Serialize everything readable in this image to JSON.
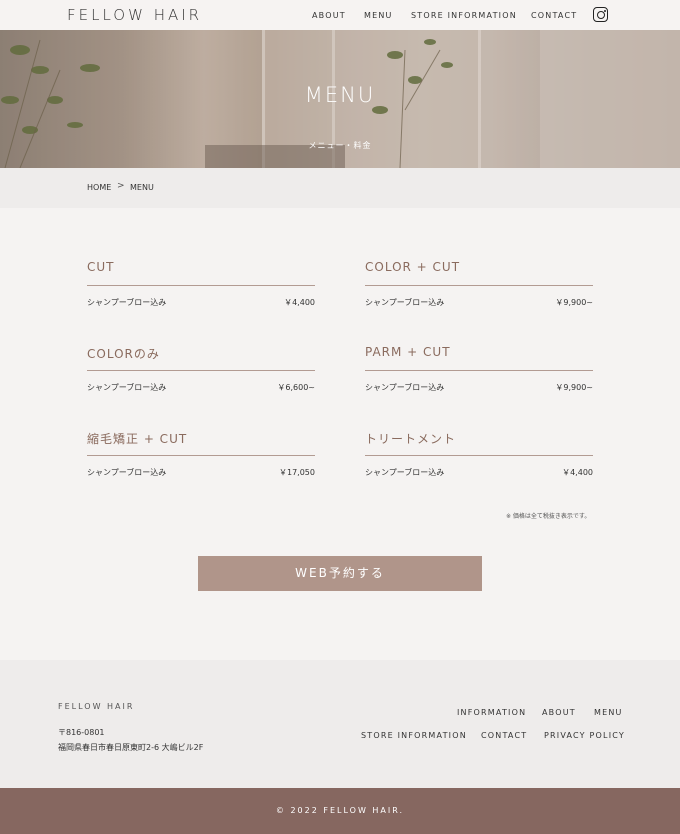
{
  "header": {
    "logo": "FELLOW HAIR",
    "nav": [
      "ABOUT",
      "MENU",
      "STORE INFORMATION",
      "CONTACT"
    ],
    "icon": "instagram-icon"
  },
  "hero": {
    "title": "MENU",
    "subtitle": "メニュー・料金"
  },
  "breadcrumb": {
    "home": "HOME",
    "separator": ">",
    "current": "MENU"
  },
  "menu": [
    {
      "name": "CUT",
      "desc": "シャンプーブロー込み",
      "price": "￥4,400"
    },
    {
      "name": "COLOR + CUT",
      "desc": "シャンプーブロー込み",
      "price": "￥9,900~"
    },
    {
      "name": "COLORのみ",
      "desc": "シャンプーブロー込み",
      "price": "￥6,600~"
    },
    {
      "name": "PARM + CUT",
      "desc": "シャンプーブロー込み",
      "price": "￥9,900~"
    },
    {
      "name": "縮毛矯正 + CUT",
      "desc": "シャンプーブロー込み",
      "price": "￥17,050"
    },
    {
      "name": "トリートメント",
      "desc": "シャンプーブロー込み",
      "price": "￥4,400"
    }
  ],
  "note": "※ 価格は全て税抜き表示です。",
  "cta": {
    "label": "WEB予約する"
  },
  "footer": {
    "logo": "FELLOW HAIR",
    "zip": "〒816-0801",
    "address": "福岡県春日市春日原東町2-6 大嶋ビル2F",
    "links_row1": [
      "INFORMATION",
      "ABOUT",
      "MENU"
    ],
    "links_row2": [
      "STORE INFORMATION",
      "CONTACT",
      "PRIVACY POLICY"
    ]
  },
  "copyright": "© 2022 FELLOW HAIR.",
  "colors": {
    "accent": "#b0958a",
    "footer_bar": "#866760",
    "menu_title": "#8a6b5e"
  }
}
